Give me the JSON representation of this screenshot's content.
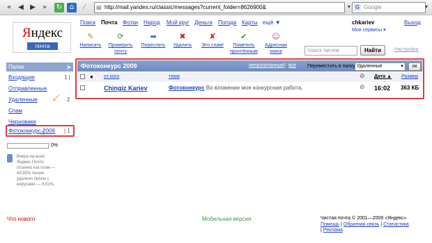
{
  "browser": {
    "url": "http://mail.yandex.ru/classic/messages?current_folder=8626900&",
    "search_placeholder": "Google"
  },
  "logo": {
    "brand_first": "Я",
    "brand_rest": "ндекс",
    "sub": "почта"
  },
  "nav": [
    {
      "label": "Поиск"
    },
    {
      "label": "Почта"
    },
    {
      "label": "Фотки"
    },
    {
      "label": "Народ"
    },
    {
      "label": "Мой круг"
    },
    {
      "label": "Деньги"
    },
    {
      "label": "Погода"
    },
    {
      "label": "Карты"
    },
    {
      "label": "ещё ▼"
    }
  ],
  "user": {
    "login": "chkariev",
    "services": "Мои сервисы ▾",
    "logout": "Выход"
  },
  "toolbar": [
    {
      "label": "Написать",
      "icon": "pencil-icon"
    },
    {
      "label": "Проверить почту",
      "icon": "refresh-icon"
    },
    {
      "label": "Переслать",
      "icon": "forward-icon"
    },
    {
      "label": "Удалить",
      "icon": "delete-icon"
    },
    {
      "label": "Это спам!",
      "icon": "spam-icon"
    },
    {
      "label": "Пометить прочтённым",
      "icon": "checkmark-icon"
    },
    {
      "label": "Адресная книга",
      "icon": "address-book-icon"
    }
  ],
  "search": {
    "placeholder": "поиск писем",
    "button": "Найти",
    "settings": "Настройка"
  },
  "sidebar": {
    "header": "Папки",
    "collapse_icon": "collapse-icon",
    "folders": [
      {
        "label": "Входящие",
        "count": "1"
      },
      {
        "label": "Отправленные",
        "count": ""
      },
      {
        "label": "Удаленные",
        "count": "2"
      },
      {
        "label": "Спам",
        "count": ""
      },
      {
        "label": "Черновики",
        "count": ""
      },
      {
        "label": "Фотоконкурс 2009",
        "count": "1"
      }
    ],
    "quota": "0%",
    "info": "Вчера на всей Яндекс.Почте: отсеяно как спам — 49,93% писем удалено писем с вирусами — 0,02%."
  },
  "mail": {
    "folder_title": "Фотоконкурс 2009",
    "unread_link": "непрочитанные",
    "all_link": "все",
    "move_label": "Переместить в папку:",
    "move_selected": "Удаленные",
    "ok": "ок",
    "columns": {
      "from": "от кого",
      "subject": "тема",
      "date": "Дата ▲",
      "size": "Размер"
    },
    "messages": [
      {
        "from": "Chingiz Kariev",
        "subject": "Фотоконкурс",
        "snippet": "Во вложении моя конкурсная работа.",
        "time": "16:02",
        "size": "363 КБ"
      }
    ]
  },
  "footer": {
    "whats_new": "Что нового",
    "mobile": "Мобильная версия",
    "copyright": "Чистая почта © 2001—2009 «Яндекс»",
    "links": [
      "Помощь",
      "Обратная связь",
      "Статистика",
      "Реклама"
    ]
  },
  "colors": {
    "highlight": "#e23b3b",
    "header": "#7a93c4",
    "link": "#1a3dc1",
    "footer_red": "#cc0000",
    "footer_green": "#3a9a3a"
  }
}
